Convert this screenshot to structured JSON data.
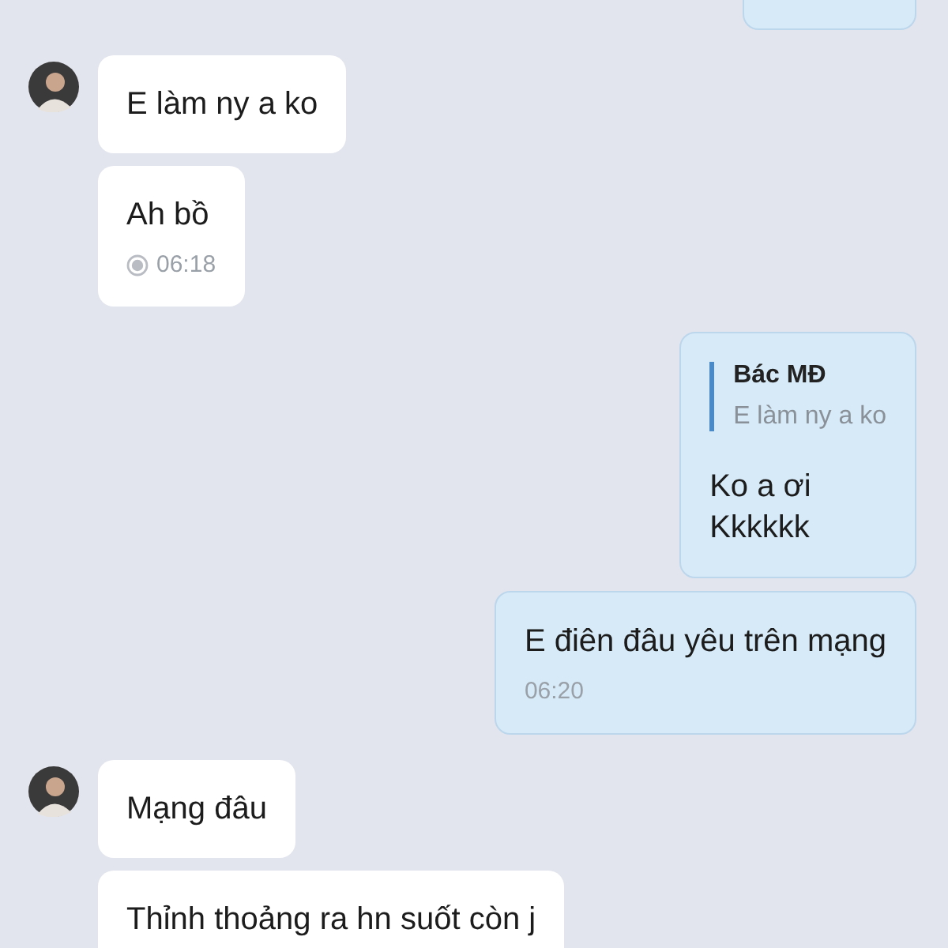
{
  "groups": [
    {
      "kind": "outgoing",
      "messages": [
        {
          "kind": "cut"
        }
      ]
    },
    {
      "kind": "incoming",
      "messages": [
        {
          "kind": "text",
          "lines": [
            "E làm ny a ko"
          ]
        },
        {
          "kind": "text",
          "lines": [
            "Ah bồ"
          ],
          "time": "06:18"
        }
      ]
    },
    {
      "kind": "outgoing",
      "messages": [
        {
          "kind": "reply",
          "quote_author": "Bác MĐ",
          "quote_text": "E làm ny a ko",
          "lines": [
            "Ko a ơi",
            "Kkkkkk"
          ]
        },
        {
          "kind": "text",
          "lines": [
            "E điên đâu yêu trên mạng"
          ],
          "time": "06:20"
        }
      ]
    },
    {
      "kind": "incoming",
      "messages": [
        {
          "kind": "text",
          "lines": [
            "Mạng đâu"
          ]
        },
        {
          "kind": "text",
          "lines": [
            "Thỉnh thoảng ra hn suốt còn j"
          ]
        }
      ]
    }
  ]
}
